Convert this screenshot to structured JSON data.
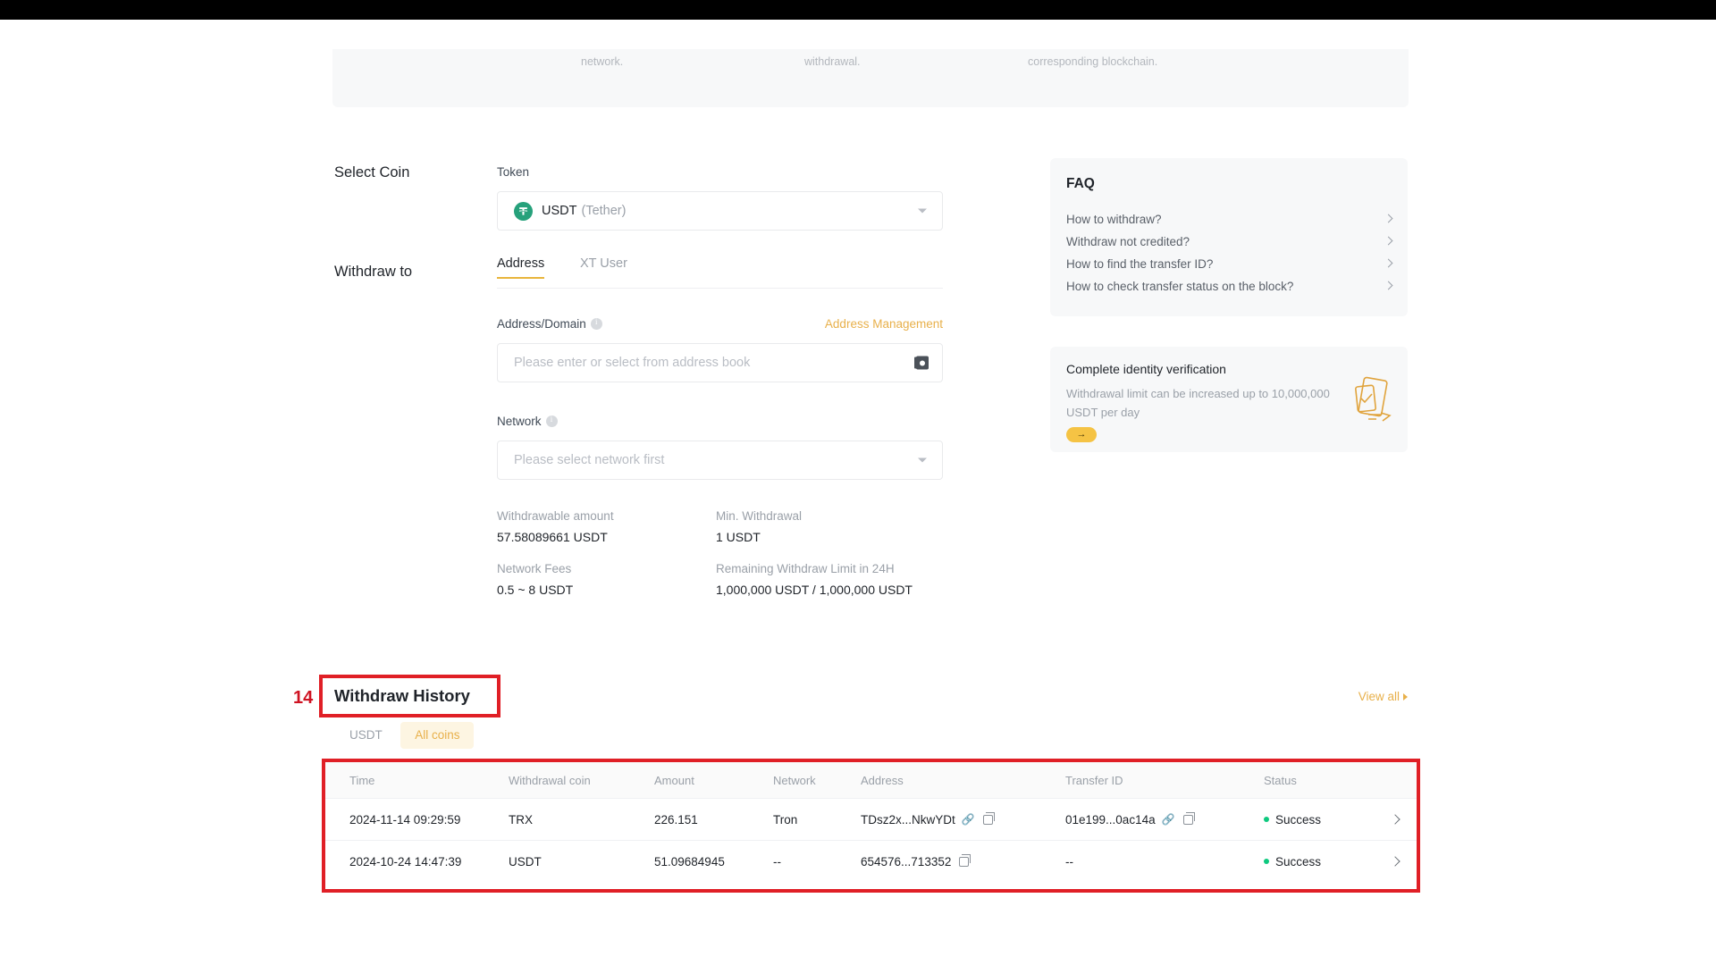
{
  "notice": {
    "columns": [
      "",
      "Internal Transfer: No need to select a network.",
      "fee. After submission, confirm the withdrawal.",
      "can track the transfer on the corresponding blockchain."
    ]
  },
  "form": {
    "select_coin_label": "Select Coin",
    "token_caption": "Token",
    "token_symbol": "USDT",
    "token_fullname": "(Tether)",
    "withdraw_to_label": "Withdraw to",
    "tabs": [
      {
        "label": "Address",
        "active": true
      },
      {
        "label": "XT User",
        "active": false
      }
    ],
    "address_caption": "Address/Domain",
    "address_management_link": "Address Management",
    "address_placeholder": "Please enter or select from address book",
    "address_value": "",
    "network_caption": "Network",
    "network_placeholder": "Please select network first",
    "info": [
      {
        "key": "Withdrawable amount",
        "value": "57.58089661 USDT"
      },
      {
        "key": "Min. Withdrawal",
        "value": "1 USDT"
      },
      {
        "key": "Network Fees",
        "value": "0.5 ~ 8 USDT"
      },
      {
        "key": "Remaining Withdraw Limit in 24H",
        "value": "1,000,000 USDT / 1,000,000 USDT"
      }
    ]
  },
  "faq": {
    "title": "FAQ",
    "items": [
      "How to withdraw?",
      "Withdraw not credited?",
      "How to find the transfer ID?",
      "How to check transfer status on the block?"
    ]
  },
  "kyc": {
    "title": "Complete identity verification",
    "description": "Withdrawal limit can be increased up to 10,000,000 USDT per day",
    "button_glyph": "→"
  },
  "history": {
    "annotation_number": "14",
    "title": "Withdraw History",
    "view_all": "View all",
    "coin_tabs": [
      {
        "label": "USDT",
        "active": false
      },
      {
        "label": "All coins",
        "active": true
      }
    ],
    "columns": [
      "Time",
      "Withdrawal coin",
      "Amount",
      "Network",
      "Address",
      "Transfer ID",
      "Status"
    ],
    "rows": [
      {
        "time": "2024-11-14 09:29:59",
        "coin": "TRX",
        "amount": "226.151",
        "network": "Tron",
        "address": "TDsz2x...NkwYDt",
        "address_has_link": true,
        "address_has_copy": true,
        "transfer_id": "01e199...0ac14a",
        "tid_has_link": true,
        "tid_has_copy": true,
        "status": "Success"
      },
      {
        "time": "2024-10-24 14:47:39",
        "coin": "USDT",
        "amount": "51.09684945",
        "network": "--",
        "address": "654576...713352",
        "address_has_link": false,
        "address_has_copy": true,
        "transfer_id": "--",
        "tid_has_link": false,
        "tid_has_copy": false,
        "status": "Success"
      }
    ]
  },
  "colors": {
    "accent": "#e8b04a",
    "annotation": "#e01f26",
    "success": "#0ec97f",
    "usdt": "#26a17b"
  }
}
